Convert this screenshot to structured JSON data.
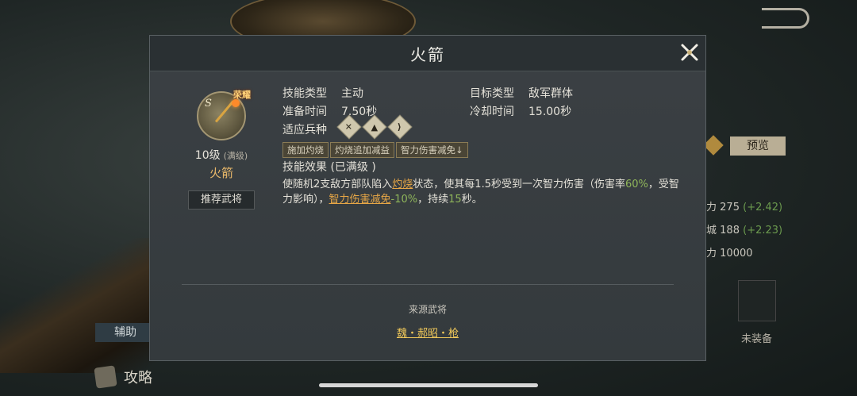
{
  "background": {
    "preview_label": "预览",
    "stats": [
      {
        "label": "力",
        "value": "275",
        "delta": "(+2.42)"
      },
      {
        "label": "城",
        "value": "188",
        "delta": "(+2.23)"
      },
      {
        "label": "力",
        "value": "10000",
        "delta": ""
      }
    ],
    "equip_label": "未装备",
    "left_tab": "辅助",
    "strategy_label": "攻略"
  },
  "modal": {
    "title": "火箭",
    "skill": {
      "grade": "S",
      "badge": "荣耀",
      "level": "10级",
      "maxed": "(满级)",
      "name": "火箭",
      "recommend_label": "推荐武将"
    },
    "info": {
      "skill_type_key": "技能类型",
      "skill_type_val": "主动",
      "target_type_key": "目标类型",
      "target_type_val": "敌军群体",
      "prep_time_key": "准备时间",
      "prep_time_val": "7.50秒",
      "cooldown_key": "冷却时间",
      "cooldown_val": "15.00秒",
      "troop_key": "适应兵种",
      "troop_icons": [
        "crossed-weapons-icon",
        "cavalry-icon",
        "archer-icon"
      ]
    },
    "tags": [
      "施加灼烧",
      "灼烧追加减益",
      "智力伤害减免↓"
    ],
    "effect_title": "技能效果 (已满级 )",
    "effect": {
      "p1": "使随机2支敌方部队陷入",
      "link1": "灼烧",
      "p2": "状态，使其每1.5秒受到一次智力伤害（伤害率",
      "rate": "60%",
      "p3": "，受智力影响），",
      "link2": "智力伤害减免",
      "p4": "-10%",
      "p5": "，持续",
      "duration": "15",
      "p6": "秒。"
    },
    "source_label": "来源武将",
    "source_hero": "魏・郝昭・枪"
  },
  "colors": {
    "accent_gold": "#e6a646",
    "green": "#8fb55a",
    "modal_bg": "#3b4044"
  }
}
